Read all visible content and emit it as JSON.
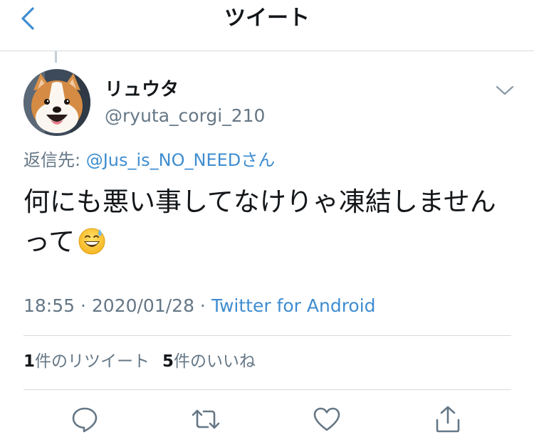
{
  "header": {
    "title": "ツイート",
    "back_icon": "chevron-left-icon"
  },
  "tweet": {
    "display_name": "リュウタ",
    "handle": "@ryuta_corgi_210",
    "reply_prefix": "返信先: ",
    "reply_mention": "@Jus_is_NO_NEED",
    "reply_suffix": "さん",
    "text": "何にも悪い事してなけりゃ凍結しませんって",
    "emoji": "grinning-face-with-sweat",
    "time": "18:55",
    "separator": " · ",
    "date": "2020/01/28",
    "source": "Twitter for Android"
  },
  "stats": {
    "retweets_count": "1",
    "retweets_label": "件のリツイート",
    "likes_count": "5",
    "likes_label": "件のいいね"
  },
  "actions": [
    "reply-icon",
    "retweet-icon",
    "like-icon",
    "share-icon"
  ],
  "colors": {
    "link": "#3f8dd0",
    "secondary_text": "#657786",
    "primary_text": "#14171a",
    "divider": "#d6d9db"
  }
}
